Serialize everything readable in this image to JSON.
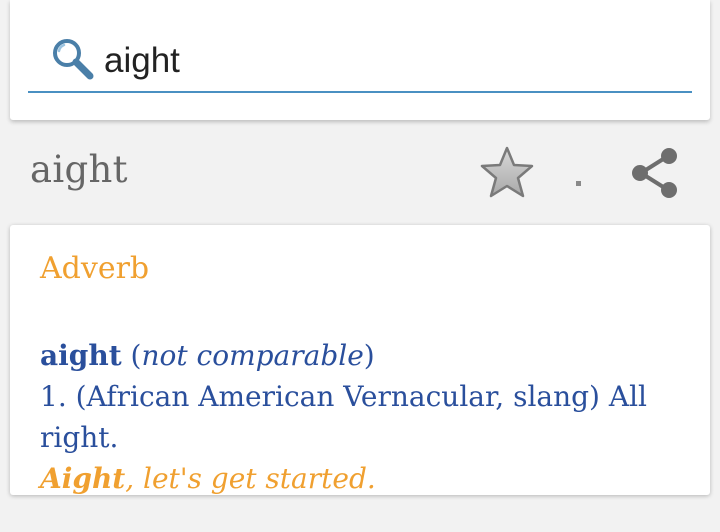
{
  "search": {
    "value": "aight",
    "accent_color": "#4a90c2"
  },
  "entry": {
    "word": "aight",
    "favorite_icon": "star-icon",
    "share_icon": "share-icon"
  },
  "definition": {
    "part_of_speech": "Adverb",
    "headword": "aight",
    "open_paren": " (",
    "grammar": "not comparable",
    "close_paren": ")",
    "sense_text": "1. (African American Vernacular, slang) All right.",
    "example_word": "Aight",
    "example_rest": ", let's get started.",
    "text_color": "#2a4f9c",
    "accent_color": "#f0a030"
  }
}
